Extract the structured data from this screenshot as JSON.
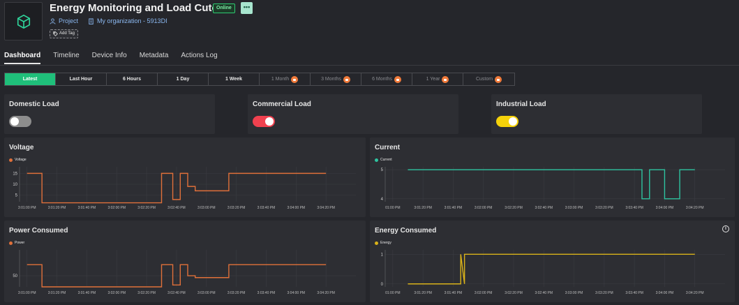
{
  "header": {
    "title": "Energy Monitoring and Load Cutoff",
    "status_badge": "Online",
    "more_label": "•••",
    "project_label": "Project",
    "organization_label": "My organization - 5913DI",
    "add_tag_label": "Add Tag"
  },
  "tabs": [
    {
      "label": "Dashboard",
      "active": true
    },
    {
      "label": "Timeline"
    },
    {
      "label": "Device Info"
    },
    {
      "label": "Metadata"
    },
    {
      "label": "Actions Log"
    }
  ],
  "time_ranges": [
    {
      "label": "Latest",
      "active": true
    },
    {
      "label": "Last Hour"
    },
    {
      "label": "6 Hours"
    },
    {
      "label": "1 Day"
    },
    {
      "label": "1 Week"
    },
    {
      "label": "1 Month",
      "locked": true
    },
    {
      "label": "3 Months",
      "locked": true
    },
    {
      "label": "6 Months",
      "locked": true
    },
    {
      "label": "1 Year",
      "locked": true
    },
    {
      "label": "Custom",
      "locked": true
    }
  ],
  "switches": [
    {
      "title": "Domestic Load",
      "state": "off",
      "color": "#8d8d8d"
    },
    {
      "title": "Commercial Load",
      "state": "on",
      "color": "#f0414f"
    },
    {
      "title": "Industrial Load",
      "state": "on",
      "color": "#f5d20a"
    }
  ],
  "chart_data": [
    {
      "type": "line",
      "title": "Voltage",
      "series": [
        {
          "name": "Voltage",
          "color": "#e0703a"
        }
      ],
      "x_ticks": [
        "3:01:00 PM",
        "3:01:20 PM",
        "3:01:40 PM",
        "3:02:00 PM",
        "3:02:20 PM",
        "3:02:40 PM",
        "3:03:00 PM",
        "3:03:20 PM",
        "3:03:40 PM",
        "3:04:00 PM",
        "3:04:20 PM"
      ],
      "y_ticks": [
        5,
        10,
        15
      ],
      "ylim": [
        2,
        18
      ],
      "x": [
        0,
        2,
        2,
        18,
        18,
        19.5,
        19.5,
        20.5,
        20.5,
        21.5,
        21.5,
        22.5,
        22.5,
        27,
        27,
        40
      ],
      "y": [
        15,
        15,
        1.5,
        1.5,
        15,
        15,
        3,
        3,
        15,
        15,
        9,
        9,
        7,
        7,
        15,
        15
      ]
    },
    {
      "type": "line",
      "title": "Current",
      "series": [
        {
          "name": "Current",
          "color": "#2ec4a0"
        }
      ],
      "x_ticks": [
        "01:00 PM",
        "3:01:20 PM",
        "3:01:40 PM",
        "3:02:00 PM",
        "3:02:20 PM",
        "3:02:40 PM",
        "3:03:00 PM",
        "3:03:20 PM",
        "3:03:40 PM",
        "3:04:00 PM",
        "3:04:20 PM"
      ],
      "y_ticks": [
        4,
        5
      ],
      "ylim": [
        3.9,
        5.1
      ],
      "x": [
        2,
        33,
        33,
        34,
        34,
        36,
        36,
        38,
        38,
        40
      ],
      "y": [
        5,
        5,
        4,
        4,
        5,
        5,
        4,
        4,
        5,
        5
      ]
    },
    {
      "type": "line",
      "title": "Power Consumed",
      "series": [
        {
          "name": "Power",
          "color": "#e0703a"
        }
      ],
      "x_ticks": [
        "3:01:00 PM",
        "3:01:20 PM",
        "3:01:40 PM",
        "3:02:00 PM",
        "3:02:20 PM",
        "3:02:40 PM",
        "3:03:00 PM",
        "3:03:20 PM",
        "3:03:40 PM",
        "3:04:00 PM",
        "3:04:20 PM"
      ],
      "y_ticks": [
        50
      ],
      "ylim": [
        20,
        120
      ],
      "x": [
        0,
        2,
        2,
        18,
        18,
        19.5,
        19.5,
        20.5,
        20.5,
        21.5,
        21.5,
        22.5,
        22.5,
        27,
        27,
        40
      ],
      "y": [
        80,
        80,
        20,
        20,
        80,
        80,
        25,
        25,
        80,
        80,
        50,
        50,
        45,
        45,
        80,
        80
      ]
    },
    {
      "type": "line",
      "title": "Energy Consumed",
      "series": [
        {
          "name": "Energy",
          "color": "#d9b21a"
        }
      ],
      "x_ticks": [
        "01:00 PM",
        "3:01:20 PM",
        "3:01:40 PM",
        "3:02:00 PM",
        "3:02:20 PM",
        "3:02:40 PM",
        "3:03:00 PM",
        "3:03:20 PM",
        "3:03:40 PM",
        "3:04:00 PM",
        "3:04:20 PM"
      ],
      "y_ticks": [
        0,
        1
      ],
      "ylim": [
        -0.1,
        1.15
      ],
      "x": [
        2,
        9,
        9,
        9.5,
        9.5,
        40
      ],
      "y": [
        0,
        0,
        1,
        0,
        1,
        1
      ]
    }
  ]
}
